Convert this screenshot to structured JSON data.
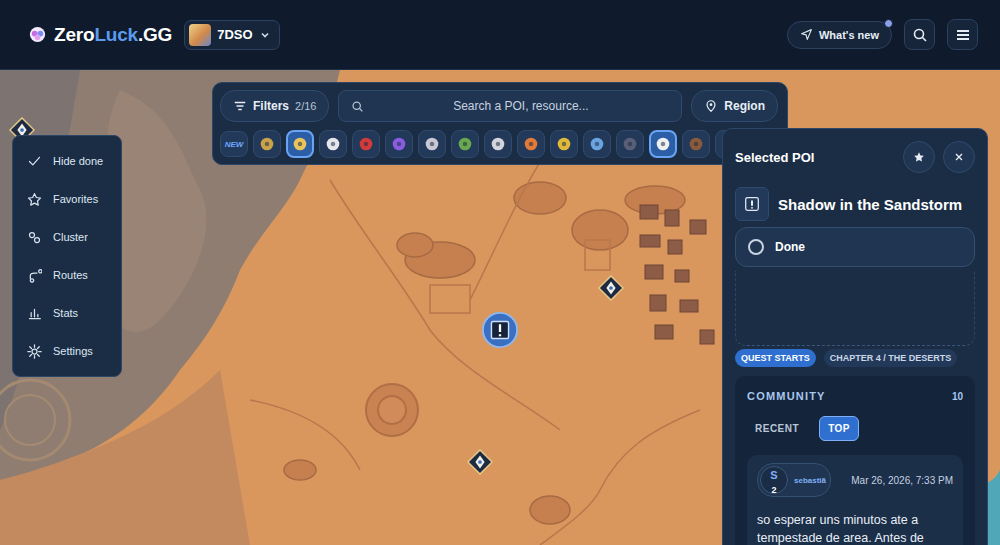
{
  "header": {
    "logo": {
      "first": "Zero",
      "accent": "Luck",
      "suffix": ".GG"
    },
    "game": "7DSO",
    "whats_new": {
      "label": "What's new",
      "has_update": true
    }
  },
  "filters": {
    "label": "Filters",
    "count": "2/16",
    "search_placeholder": "Search a POI, resource...",
    "region": "Region"
  },
  "new_chip": "NEW",
  "categories": [
    {
      "selected": false,
      "color": "#c9a24a"
    },
    {
      "selected": true,
      "color": "#e8c45a"
    },
    {
      "selected": false,
      "color": "#e6e6ea"
    },
    {
      "selected": false,
      "color": "#d33a3a"
    },
    {
      "selected": false,
      "color": "#8a5ce0"
    },
    {
      "selected": false,
      "color": "#c8c8d4"
    },
    {
      "selected": false,
      "color": "#6aa84f"
    },
    {
      "selected": false,
      "color": "#d4d4dc"
    },
    {
      "selected": false,
      "color": "#e07b39"
    },
    {
      "selected": false,
      "color": "#e0b83a"
    },
    {
      "selected": false,
      "color": "#6aa3e0"
    },
    {
      "selected": false,
      "color": "#5a5f78"
    },
    {
      "selected": true,
      "color": "#f0f0f0"
    },
    {
      "selected": false,
      "color": "#8a5a3a"
    },
    {
      "selected": false,
      "color": "#d0d0d8"
    }
  ],
  "side_menu": [
    {
      "label": "Hide done"
    },
    {
      "label": "Favorites"
    },
    {
      "label": "Cluster"
    },
    {
      "label": "Routes"
    },
    {
      "label": "Stats"
    },
    {
      "label": "Settings"
    }
  ],
  "map_pins": [
    {
      "selected": true
    },
    {
      "selected": false
    },
    {
      "selected": false
    },
    {
      "selected": false
    }
  ],
  "poi": {
    "panel_title": "Selected POI",
    "name": "Shadow in the Sandstorm",
    "done": {
      "label": "Done",
      "checked": false
    },
    "tags": [
      {
        "label": "QUEST STARTS",
        "selected": true
      },
      {
        "label": "CHAPTER 4 / THE DESERTS",
        "selected": false
      }
    ]
  },
  "community": {
    "title": "COMMUNITY",
    "count": "10",
    "tabs": [
      {
        "label": "RECENT",
        "selected": false
      },
      {
        "label": "TOP",
        "selected": true
      }
    ],
    "comments": [
      {
        "avatar": "S",
        "badge": "2",
        "author": "sebastiã",
        "date": "Mar 26, 2026, 7:33 PM",
        "text": "so esperar uns minutos ate a tempestade de area. Antes de"
      }
    ]
  }
}
